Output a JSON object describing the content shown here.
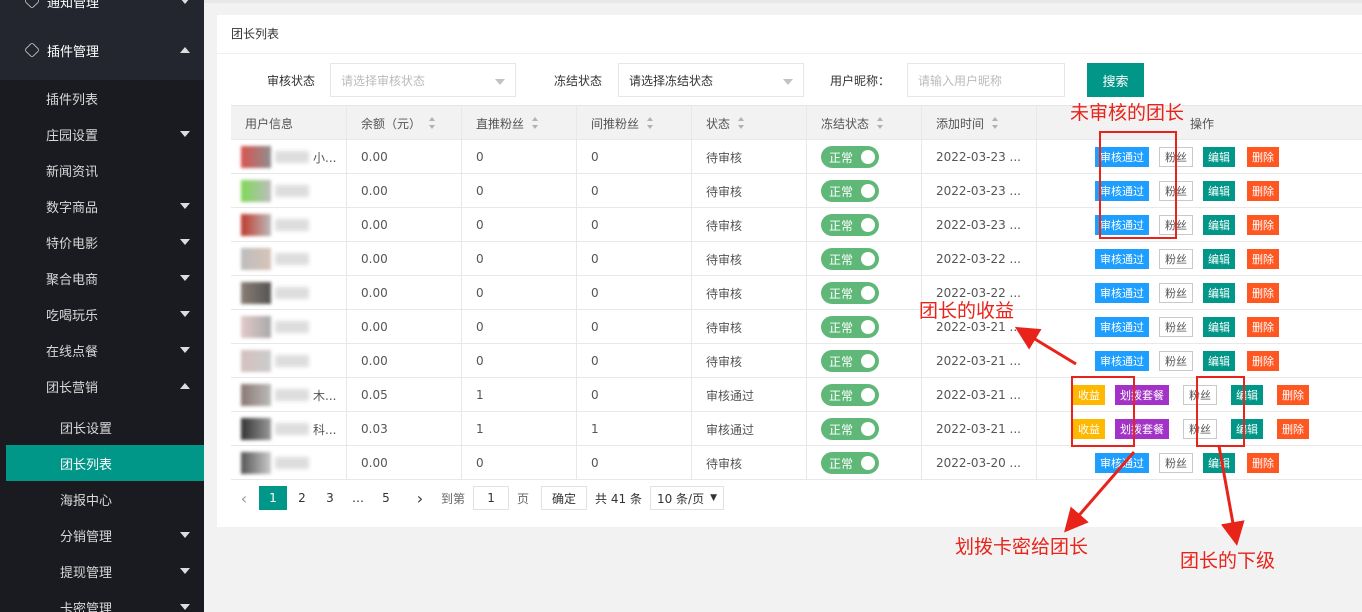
{
  "sidebar": {
    "top_label": "通知管理",
    "group_label": "插件管理",
    "items": [
      {
        "label": "插件列表"
      },
      {
        "label": "庄园设置"
      },
      {
        "label": "新闻资讯"
      },
      {
        "label": "数字商品"
      },
      {
        "label": "特价电影"
      },
      {
        "label": "聚合电商"
      },
      {
        "label": "吃喝玩乐"
      },
      {
        "label": "在线点餐"
      },
      {
        "label": "团长营销"
      }
    ],
    "subitems": [
      {
        "label": "团长设置"
      },
      {
        "label": "团长列表"
      },
      {
        "label": "海报中心"
      },
      {
        "label": "分销管理"
      },
      {
        "label": "提现管理"
      },
      {
        "label": "卡密管理"
      }
    ]
  },
  "panel": {
    "title": "团长列表"
  },
  "filters": {
    "audit_label": "审核状态",
    "audit_placeholder": "请选择审核状态",
    "freeze_label": "冻结状态",
    "freeze_value": "请选择冻结状态",
    "nick_label": "用户昵称：",
    "nick_placeholder": "请输入用户昵称",
    "search_label": "搜索"
  },
  "table": {
    "headers": [
      "用户信息",
      "余额（元）",
      "直推粉丝",
      "间推粉丝",
      "状态",
      "冻结状态",
      "添加时间",
      "操作"
    ],
    "rows": [
      {
        "user": "小...",
        "balance": "0.00",
        "direct": "0",
        "indirect": "0",
        "status": "待审核",
        "freeze": "正常",
        "time": "2022-03-23 ...",
        "type": "pending"
      },
      {
        "user": "",
        "balance": "0.00",
        "direct": "0",
        "indirect": "0",
        "status": "待审核",
        "freeze": "正常",
        "time": "2022-03-23 ...",
        "type": "pending"
      },
      {
        "user": "",
        "balance": "0.00",
        "direct": "0",
        "indirect": "0",
        "status": "待审核",
        "freeze": "正常",
        "time": "2022-03-23 ...",
        "type": "pending"
      },
      {
        "user": "",
        "balance": "0.00",
        "direct": "0",
        "indirect": "0",
        "status": "待审核",
        "freeze": "正常",
        "time": "2022-03-22 ...",
        "type": "pending"
      },
      {
        "user": "",
        "balance": "0.00",
        "direct": "0",
        "indirect": "0",
        "status": "待审核",
        "freeze": "正常",
        "time": "2022-03-22 ...",
        "type": "pending"
      },
      {
        "user": "",
        "balance": "0.00",
        "direct": "0",
        "indirect": "0",
        "status": "待审核",
        "freeze": "正常",
        "time": "2022-03-21 ...",
        "type": "pending"
      },
      {
        "user": "",
        "balance": "0.00",
        "direct": "0",
        "indirect": "0",
        "status": "待审核",
        "freeze": "正常",
        "time": "2022-03-21 ...",
        "type": "pending"
      },
      {
        "user": "木...",
        "balance": "0.05",
        "direct": "1",
        "indirect": "0",
        "status": "审核通过",
        "freeze": "正常",
        "time": "2022-03-21 ...",
        "type": "approved"
      },
      {
        "user": "科...",
        "balance": "0.03",
        "direct": "1",
        "indirect": "1",
        "status": "审核通过",
        "freeze": "正常",
        "time": "2022-03-21 ...",
        "type": "approved"
      },
      {
        "user": "",
        "balance": "0.00",
        "direct": "0",
        "indirect": "0",
        "status": "待审核",
        "freeze": "正常",
        "time": "2022-03-20 ...",
        "type": "pending"
      }
    ],
    "ops": {
      "approve": "审核通过",
      "fans": "粉丝",
      "edit": "编辑",
      "delete": "删除",
      "income": "收益",
      "allot": "划拨套餐"
    }
  },
  "pager": {
    "prev": "‹",
    "pages": [
      "1",
      "2",
      "3",
      "…",
      "5"
    ],
    "next": "›",
    "goto_label": "到第",
    "goto_value": "1",
    "page_unit": "页",
    "confirm": "确定",
    "total": "共 41 条",
    "size": "10 条/页"
  },
  "annotations": {
    "unapproved": "未审核的团长",
    "income": "团长的收益",
    "allot": "划拨卡密给团长",
    "subordinate": "团长的下级"
  },
  "colors": {
    "sidebar_bg": "#23262e",
    "accent": "#009688",
    "annotation": "#e8231a"
  }
}
